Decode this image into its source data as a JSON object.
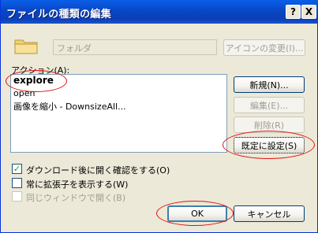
{
  "window": {
    "title": "ファイルの種類の編集"
  },
  "titlebar_buttons": {
    "help": "?",
    "close": "X"
  },
  "type_name": {
    "value": "フォルダ"
  },
  "change_icon_button": "アイコンの変更(I)...",
  "actions": {
    "label": "アクション(A):",
    "items": [
      {
        "label": "explore",
        "default": true
      },
      {
        "label": "open",
        "default": false
      },
      {
        "label": "画像を縮小 - DownsizeAll...",
        "default": false
      }
    ]
  },
  "side_buttons": {
    "new": "新規(N)...",
    "edit": "編集(E)...",
    "delete": "削除(R)",
    "set_default": "既定に設定(S)"
  },
  "checkboxes": [
    {
      "label": "ダウンロード後に開く確認をする(O)",
      "checked": true,
      "enabled": true
    },
    {
      "label": "常に拡張子を表示する(W)",
      "checked": false,
      "enabled": true
    },
    {
      "label": "同じウィンドウで開く(B)",
      "checked": false,
      "enabled": false
    }
  ],
  "footer": {
    "ok": "OK",
    "cancel": "キャンセル"
  }
}
